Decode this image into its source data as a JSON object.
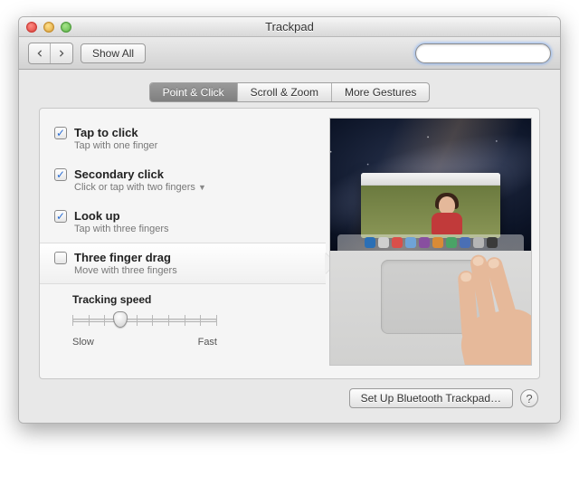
{
  "window": {
    "title": "Trackpad"
  },
  "toolbar": {
    "show_all": "Show All",
    "search_placeholder": ""
  },
  "tabs": [
    {
      "label": "Point & Click",
      "active": true
    },
    {
      "label": "Scroll & Zoom",
      "active": false
    },
    {
      "label": "More Gestures",
      "active": false
    }
  ],
  "options": [
    {
      "checked": true,
      "title": "Tap to click",
      "subtitle": "Tap with one finger",
      "has_dropdown": false,
      "selected": false
    },
    {
      "checked": true,
      "title": "Secondary click",
      "subtitle": "Click or tap with two fingers",
      "has_dropdown": true,
      "selected": false
    },
    {
      "checked": true,
      "title": "Look up",
      "subtitle": "Tap with three fingers",
      "has_dropdown": false,
      "selected": false
    },
    {
      "checked": false,
      "title": "Three finger drag",
      "subtitle": "Move with three fingers",
      "has_dropdown": false,
      "selected": true
    }
  ],
  "tracking": {
    "label": "Tracking speed",
    "min_label": "Slow",
    "max_label": "Fast",
    "ticks": 10,
    "value_index": 3
  },
  "footer": {
    "bluetooth": "Set Up Bluetooth Trackpad…",
    "help": "?"
  },
  "dock_colors": [
    "#2b6fb5",
    "#cfcfcf",
    "#d94f4a",
    "#6fa3d6",
    "#884fa0",
    "#d98b36",
    "#4aa366",
    "#4a6fb5",
    "#b5b5b5",
    "#3a3a3a"
  ]
}
